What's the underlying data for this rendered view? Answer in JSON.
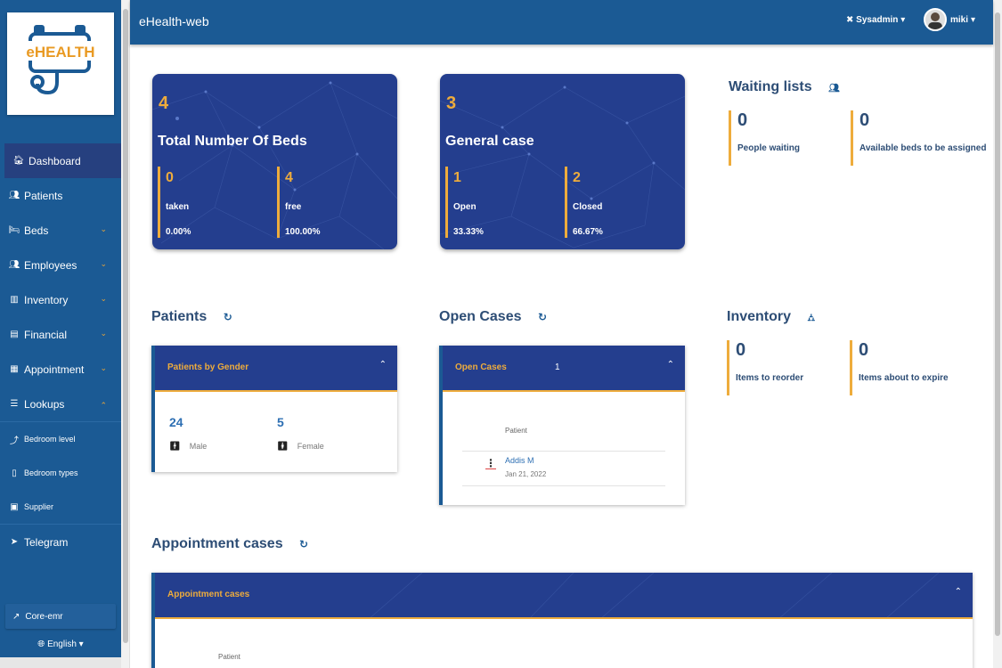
{
  "app": {
    "title": "eHealth-web",
    "logo_text": "eHEALTH"
  },
  "topbar": {
    "role_label": "Sysadmin",
    "user_name": "miki"
  },
  "sidebar": {
    "items": [
      {
        "label": "Dashboard",
        "icon": "home-icon"
      },
      {
        "label": "Patients",
        "icon": "users-icon"
      },
      {
        "label": "Beds",
        "icon": "bed-icon"
      },
      {
        "label": "Employees",
        "icon": "users-icon"
      },
      {
        "label": "Inventory",
        "icon": "building-icon"
      },
      {
        "label": "Financial",
        "icon": "money-icon"
      },
      {
        "label": "Appointment",
        "icon": "calendar-icon"
      },
      {
        "label": "Lookups",
        "icon": "list-icon"
      }
    ],
    "lookup_items": [
      {
        "label": "Bedroom level"
      },
      {
        "label": "Bedroom types"
      },
      {
        "label": "Supplier"
      }
    ],
    "telegram": "Telegram",
    "core_emr": "Core-emr",
    "language": "English"
  },
  "beds_card": {
    "count": "4",
    "title": "Total Number Of Beds",
    "taken": {
      "value": "0",
      "label": "taken",
      "percent": "0.00%"
    },
    "free": {
      "value": "4",
      "label": "free",
      "percent": "100.00%"
    }
  },
  "cases_card": {
    "count": "3",
    "title": "General case",
    "open": {
      "value": "1",
      "label": "Open",
      "percent": "33.33%"
    },
    "closed": {
      "value": "2",
      "label": "Closed",
      "percent": "66.67%"
    }
  },
  "waiting": {
    "title": "Waiting lists",
    "people": {
      "value": "0",
      "label": "People waiting"
    },
    "beds": {
      "value": "0",
      "label": "Available beds to be assigned"
    }
  },
  "patients_section": {
    "title": "Patients",
    "panel_title": "Patients by Gender",
    "male": {
      "value": "24",
      "label": "Male"
    },
    "female": {
      "value": "5",
      "label": "Female"
    }
  },
  "open_cases_section": {
    "title": "Open Cases",
    "panel_title": "Open Cases",
    "count": "1",
    "column": "Patient",
    "rows": [
      {
        "name": "Addis M",
        "date": "Jan 21, 2022"
      }
    ]
  },
  "inventory_section": {
    "title": "Inventory",
    "reorder": {
      "value": "0",
      "label": "Items to reorder"
    },
    "expire": {
      "value": "0",
      "label": "Items about to expire"
    }
  },
  "appointment_section": {
    "title": "Appointment cases",
    "panel_title": "Appointment cases",
    "column": "Patient"
  },
  "colors": {
    "primary": "#1b5a94",
    "card": "#243e8e",
    "accent": "#eeac3c",
    "text": "#2d4d75"
  }
}
